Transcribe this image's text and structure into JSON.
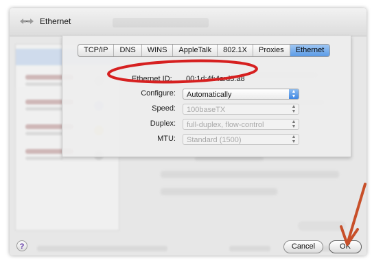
{
  "window": {
    "title": "Ethernet"
  },
  "tabs": [
    {
      "label": "TCP/IP"
    },
    {
      "label": "DNS"
    },
    {
      "label": "WINS"
    },
    {
      "label": "AppleTalk"
    },
    {
      "label": "802.1X"
    },
    {
      "label": "Proxies"
    },
    {
      "label": "Ethernet",
      "active": true
    }
  ],
  "ethernet": {
    "id_label": "Ethernet ID:",
    "id_value": "00:1d:4f:4a:d3:a8",
    "configure_label": "Configure:",
    "configure_value": "Automatically",
    "speed_label": "Speed:",
    "speed_value": "100baseTX",
    "duplex_label": "Duplex:",
    "duplex_value": "full-duplex, flow-control",
    "mtu_label": "MTU:",
    "mtu_value": "Standard  (1500)"
  },
  "buttons": {
    "help": "?",
    "cancel": "Cancel",
    "ok": "OK"
  },
  "colors": {
    "highlight_ellipse": "#d62020",
    "arrow": "#c8502a",
    "active_tab": "#5b9be6"
  },
  "icons": {
    "title": "network-arrows-icon",
    "select": "chevron-updown-icon"
  }
}
